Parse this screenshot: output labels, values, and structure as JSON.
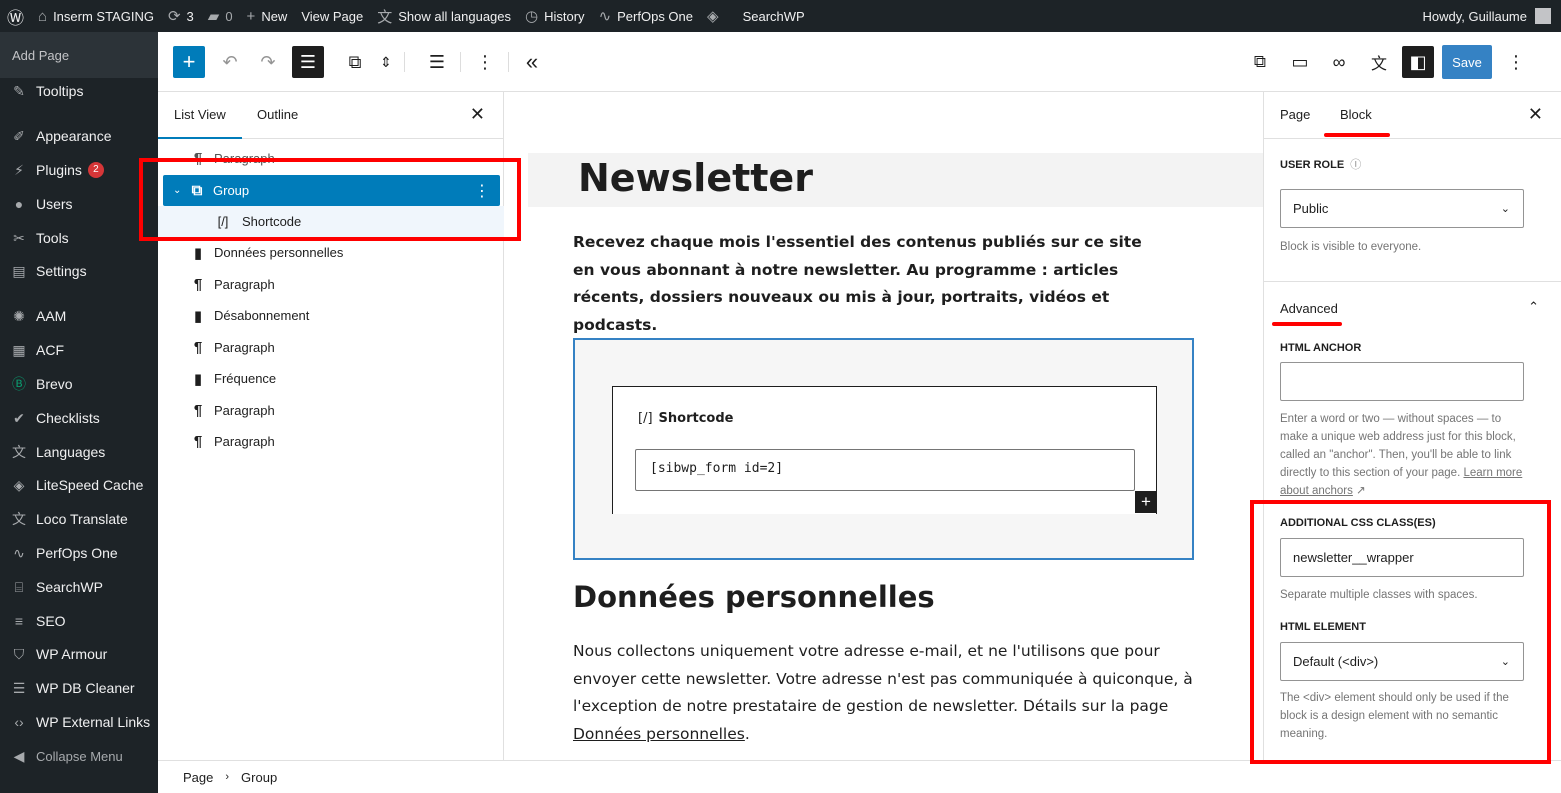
{
  "admin_bar": {
    "site_name": "Inserm STAGING",
    "updates_count": "3",
    "comments_count": "0",
    "new_label": "New",
    "view_page_label": "View Page",
    "show_languages_label": "Show all languages",
    "history_label": "History",
    "perfops_label": "PerfOps One",
    "searchwp_label": "SearchWP",
    "howdy": "Howdy, Guillaume"
  },
  "admin_menu": {
    "add_page": "Add Page",
    "items": [
      {
        "label": "Tooltips",
        "icon": "pin-icon"
      },
      {
        "label": "Appearance",
        "icon": "brush-icon"
      },
      {
        "label": "Plugins",
        "icon": "plugin-icon",
        "badge": "2"
      },
      {
        "label": "Users",
        "icon": "users-icon"
      },
      {
        "label": "Tools",
        "icon": "wrench-icon"
      },
      {
        "label": "Settings",
        "icon": "settings-icon"
      },
      {
        "label": "AAM",
        "icon": "aam-icon"
      },
      {
        "label": "ACF",
        "icon": "acf-icon"
      },
      {
        "label": "Brevo",
        "icon": "brevo-icon"
      },
      {
        "label": "Checklists",
        "icon": "check-icon"
      },
      {
        "label": "Languages",
        "icon": "translate-icon"
      },
      {
        "label": "LiteSpeed Cache",
        "icon": "diamond-icon"
      },
      {
        "label": "Loco Translate",
        "icon": "translate-icon"
      },
      {
        "label": "PerfOps One",
        "icon": "pulse-icon"
      },
      {
        "label": "SearchWP",
        "icon": "searchwp-icon"
      },
      {
        "label": "SEO",
        "icon": "seo-icon"
      },
      {
        "label": "WP Armour",
        "icon": "shield-icon"
      },
      {
        "label": "WP DB Cleaner",
        "icon": "database-icon"
      },
      {
        "label": "WP External Links",
        "icon": "code-icon"
      },
      {
        "label": "Collapse Menu",
        "icon": "collapse-icon"
      }
    ]
  },
  "toolbar": {
    "save_label": "Save"
  },
  "list_view": {
    "tab_list": "List View",
    "tab_outline": "Outline",
    "rows": [
      {
        "label": "Paragraph",
        "icon": "paragraph-icon"
      },
      {
        "label": "Group",
        "icon": "group-icon"
      },
      {
        "label": "Shortcode",
        "icon": "shortcode-icon"
      },
      {
        "label": "Données personnelles",
        "icon": "bookmark-icon"
      },
      {
        "label": "Paragraph",
        "icon": "paragraph-icon"
      },
      {
        "label": "Désabonnement",
        "icon": "bookmark-icon"
      },
      {
        "label": "Paragraph",
        "icon": "paragraph-icon"
      },
      {
        "label": "Fréquence",
        "icon": "bookmark-icon"
      },
      {
        "label": "Paragraph",
        "icon": "paragraph-icon"
      },
      {
        "label": "Paragraph",
        "icon": "paragraph-icon"
      }
    ]
  },
  "canvas": {
    "title": "Newsletter",
    "lead": "Recevez chaque mois l'essentiel des contenus publiés sur ce site en vous abonnant à notre newsletter. Au programme : articles récents, dossiers nouveaux ou mis à jour, portraits, vidéos et podcasts.",
    "shortcode_label": "Shortcode",
    "shortcode_value": "[sibwp_form id=2]",
    "heading2": "Données personnelles",
    "paragraph_text": "Nous collectons uniquement votre adresse e-mail, et ne l'utilisons que pour envoyer cette newsletter. Votre adresse n'est pas communiquée à quiconque, à l'exception de notre prestataire de gestion de newsletter. Détails sur la page ",
    "paragraph_link": "Données personnelles",
    "paragraph_end": "."
  },
  "breadcrumb": {
    "root": "Page",
    "current": "Group"
  },
  "sidebar": {
    "tab_page": "Page",
    "tab_block": "Block",
    "user_role_label": "USER ROLE",
    "user_role_value": "Public",
    "user_role_help": "Block is visible to everyone.",
    "advanced_label": "Advanced",
    "html_anchor_label": "HTML ANCHOR",
    "html_anchor_value": "",
    "html_anchor_help": "Enter a word or two — without spaces — to make a unique web address just for this block, called an \"anchor\". Then, you'll be able to link directly to this section of your page.",
    "html_anchor_link": "Learn more about anchors",
    "css_class_label": "ADDITIONAL CSS CLASS(ES)",
    "css_class_value": "newsletter__wrapper",
    "css_class_help": "Separate multiple classes with spaces.",
    "html_element_label": "HTML ELEMENT",
    "html_element_value": "Default (<div>)",
    "html_element_help": "The <div> element should only be used if the block is a design element with no semantic meaning."
  },
  "colors": {
    "accent": "#007cba",
    "highlight": "#ff0000",
    "admin_dark": "#1d2327"
  }
}
